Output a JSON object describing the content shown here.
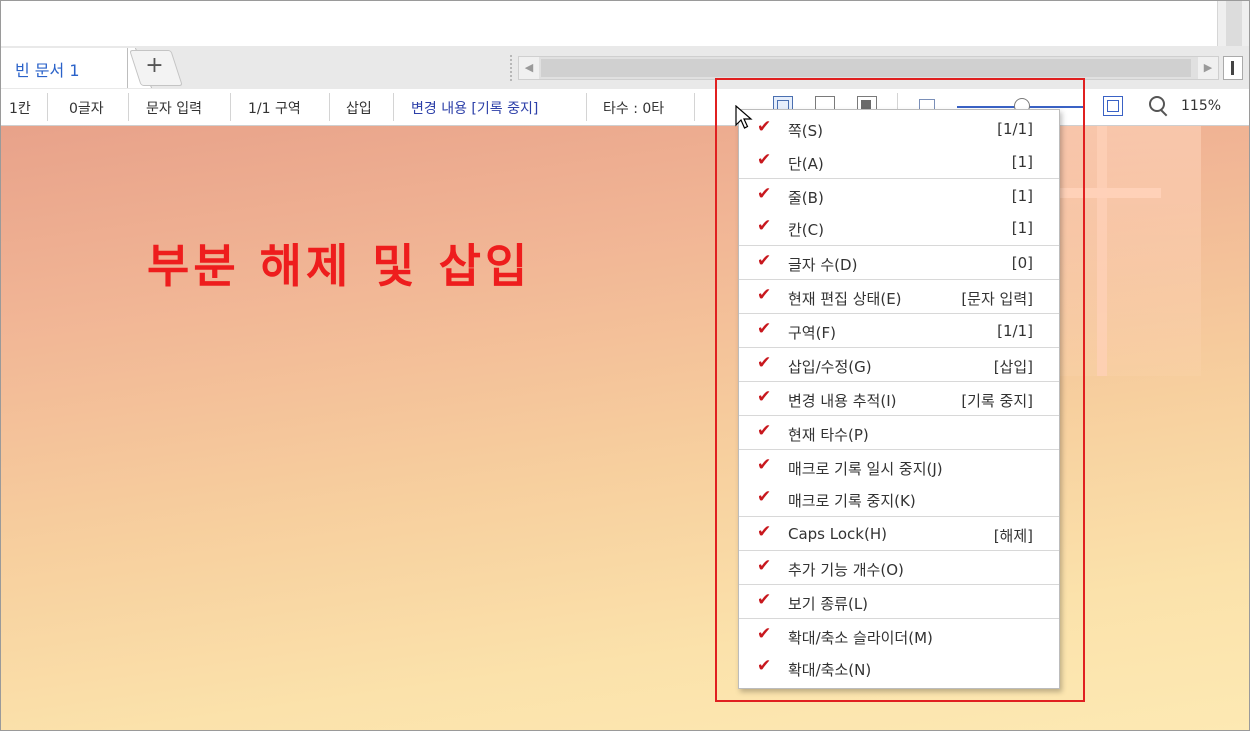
{
  "tabs": {
    "active_label": "빈 문서 1",
    "add_label": "+"
  },
  "statusbar": {
    "col": "1칸",
    "chars": "0글자",
    "edit_state": "문자 입력",
    "section": "1/1 구역",
    "insert_mode": "삽입",
    "track_changes": "변경 내용 [기록 중지]",
    "typing_speed": "타수 : 0타",
    "zoom": "115%"
  },
  "heading": "부분 해제 및 삽입",
  "menu": {
    "items": [
      {
        "label": "쪽(S)",
        "value": "[1/1]",
        "checked": true
      },
      {
        "label": "단(A)",
        "value": "[1]",
        "checked": true
      },
      {
        "label": "줄(B)",
        "value": "[1]",
        "checked": true
      },
      {
        "label": "칸(C)",
        "value": "[1]",
        "checked": true
      },
      {
        "label": "글자 수(D)",
        "value": "[0]",
        "checked": true
      },
      {
        "label": "현재 편집 상태(E)",
        "value": "[문자 입력]",
        "checked": true
      },
      {
        "label": "구역(F)",
        "value": "[1/1]",
        "checked": true
      },
      {
        "label": "삽입/수정(G)",
        "value": "[삽입]",
        "checked": true
      },
      {
        "label": "변경 내용 추적(I)",
        "value": "[기록 중지]",
        "checked": true
      },
      {
        "label": "현재 타수(P)",
        "value": "",
        "checked": true
      },
      {
        "label": "매크로 기록 일시 중지(J)",
        "value": "",
        "checked": true
      },
      {
        "label": "매크로 기록 중지(K)",
        "value": "",
        "checked": true
      },
      {
        "label": "Caps Lock(H)",
        "value": "[해제]",
        "checked": true
      },
      {
        "label": "추가 기능 개수(O)",
        "value": "",
        "checked": true
      },
      {
        "label": "보기 종류(L)",
        "value": "",
        "checked": true
      },
      {
        "label": "확대/축소 슬라이더(M)",
        "value": "",
        "checked": true
      },
      {
        "label": "확대/축소(N)",
        "value": "",
        "checked": true
      }
    ]
  },
  "colors": {
    "accent_red": "#ee1d1d",
    "check_red": "#c8181e",
    "tab_blue": "#2a62c9",
    "track_blue": "#2c3fa8"
  }
}
